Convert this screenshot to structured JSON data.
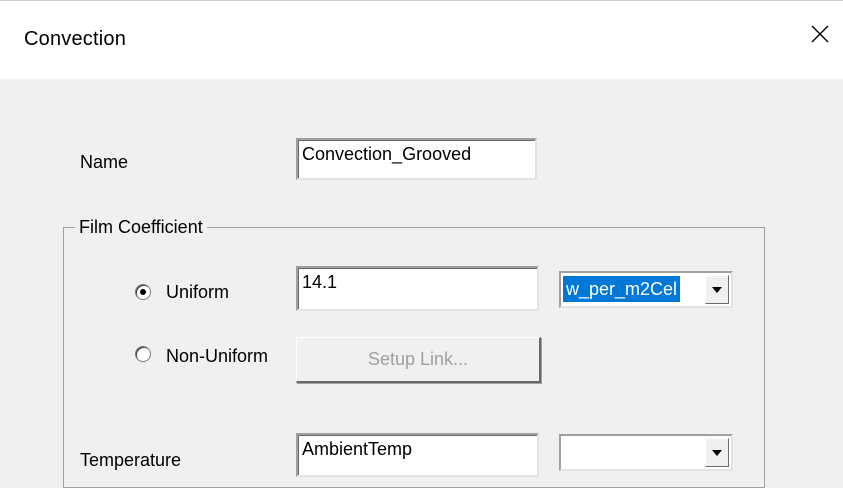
{
  "window": {
    "title": "Convection",
    "close_icon": "close-icon"
  },
  "form": {
    "name_label": "Name",
    "name_value": "Convection_Grooved",
    "film_group_label": "Film Coefficient",
    "uniform_label": "Uniform",
    "uniform_selected": true,
    "uniform_value": "14.1",
    "units_value": "w_per_m2Cel",
    "nonuniform_label": "Non-Uniform",
    "nonuniform_selected": false,
    "setup_link_label": "Setup Link...",
    "temperature_label": "Temperature",
    "temperature_value": "AmbientTemp",
    "temperature_units_value": ""
  },
  "colors": {
    "selection": "#0078d7",
    "dialog_bg": "#f0f0f0",
    "disabled_text": "#a0a0a0"
  }
}
